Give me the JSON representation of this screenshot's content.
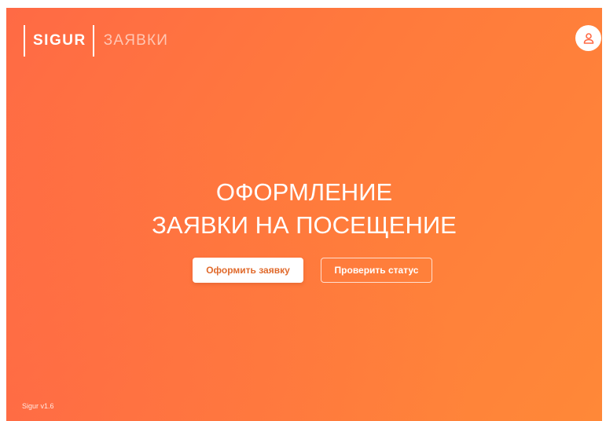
{
  "header": {
    "brand": "SIGUR",
    "module": "ЗАЯВКИ",
    "profile_icon": "user-icon"
  },
  "hero": {
    "title_line1": "ОФОРМЛЕНИЕ",
    "title_line2": "ЗАЯВКИ НА ПОСЕЩЕНИЕ"
  },
  "actions": {
    "submit_label": "Оформить заявку",
    "check_status_label": "Проверить статус"
  },
  "footer": {
    "version": "Sigur v1.6"
  },
  "colors": {
    "gradient_start": "#ff6a45",
    "gradient_end": "#ff8838",
    "primary_button_text": "#e06a2c"
  }
}
